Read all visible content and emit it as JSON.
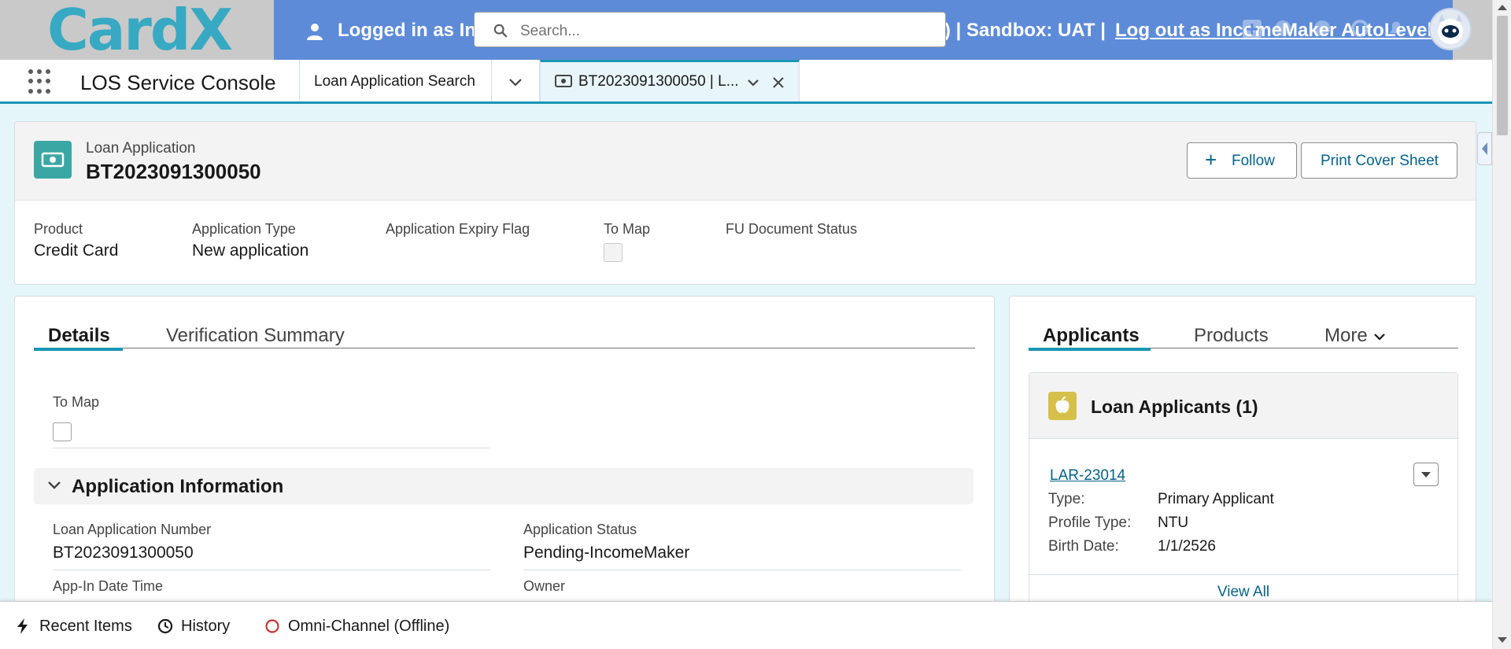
{
  "banner": {
    "logo": "CardX",
    "logged_in": "Logged in as Inc",
    "sandbox": ") | Sandbox: UAT |",
    "logout": "Log out as IncomeMaker AutoLevel30"
  },
  "search": {
    "placeholder": "Search..."
  },
  "console": {
    "app_name": "LOS Service Console",
    "tabs": [
      {
        "label": "Loan Application Search"
      },
      {
        "label": "BT2023091300050 | L..."
      }
    ]
  },
  "record": {
    "object_type": "Loan Application",
    "name": "BT2023091300050",
    "actions": {
      "follow": "Follow",
      "print": "Print Cover Sheet"
    },
    "highlights": [
      {
        "label": "Product",
        "value": "Credit Card"
      },
      {
        "label": "Application Type",
        "value": "New application"
      },
      {
        "label": "Application Expiry Flag",
        "value": ""
      },
      {
        "label": "To Map",
        "value": ""
      },
      {
        "label": "FU Document Status",
        "value": ""
      }
    ]
  },
  "details": {
    "tabs": [
      "Details",
      "Verification Summary"
    ],
    "to_map_label": "To Map",
    "section_title": "Application Information",
    "fields": [
      {
        "label": "Loan Application Number",
        "value": "BT2023091300050"
      },
      {
        "label": "Application Status",
        "value": "Pending-IncomeMaker"
      },
      {
        "label": "App-In Date Time",
        "value": ""
      },
      {
        "label": "Owner",
        "value": ""
      }
    ]
  },
  "related": {
    "tabs": [
      "Applicants",
      "Products",
      "More"
    ],
    "list_title": "Loan Applicants (1)",
    "record_link": "LAR-23014",
    "rows": [
      {
        "label": "Type:",
        "value": "Primary Applicant"
      },
      {
        "label": "Profile Type:",
        "value": "NTU"
      },
      {
        "label": "Birth Date:",
        "value": "1/1/2526"
      }
    ],
    "view_all": "View All"
  },
  "utility_bar": {
    "recent": "Recent Items",
    "history": "History",
    "omni": "Omni-Channel (Offline)"
  },
  "colors": {
    "brand_blue": "#5d8bd8",
    "accent_teal": "#1b96b3",
    "record_icon": "#3ba7a4",
    "applicant_icon": "#d6c04a",
    "omni_offline": "#c23934"
  }
}
